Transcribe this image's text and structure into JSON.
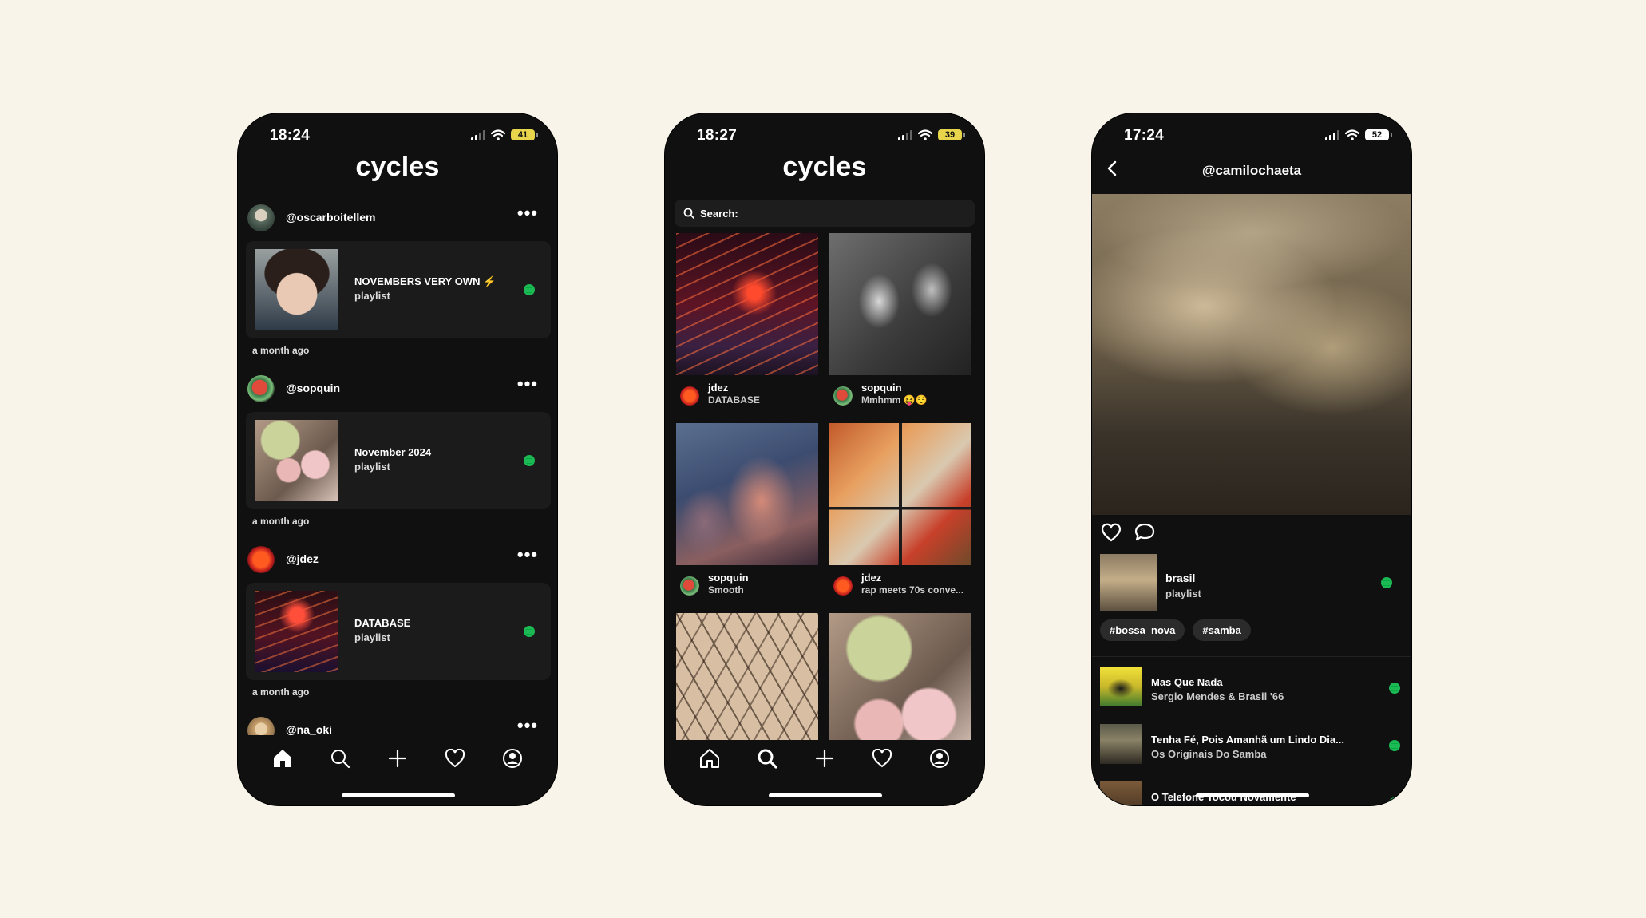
{
  "screen1": {
    "time": "18:24",
    "battery": "41",
    "app_title": "cycles",
    "posts": [
      {
        "user": "@oscarboitellem",
        "title": "NOVEMBERS VERY OWN",
        "type": "playlist",
        "ago": "a month ago"
      },
      {
        "user": "@sopquin",
        "title": "November 2024",
        "type": "playlist",
        "ago": "a month ago"
      },
      {
        "user": "@jdez",
        "title": "DATABASE",
        "type": "playlist",
        "ago": "a month ago"
      },
      {
        "user": "@na_oki"
      }
    ]
  },
  "screen2": {
    "time": "18:27",
    "battery": "39",
    "app_title": "cycles",
    "search_placeholder": "Search:",
    "grid": [
      {
        "user": "jdez",
        "desc": "DATABASE"
      },
      {
        "user": "sopquin",
        "desc": "Mmhmm 😝😌"
      },
      {
        "user": "sopquin",
        "desc": "Smooth"
      },
      {
        "user": "jdez",
        "desc": "rap meets 70s conve..."
      },
      {
        "user": "",
        "desc": ""
      },
      {
        "user": "",
        "desc": ""
      }
    ]
  },
  "screen3": {
    "time": "17:24",
    "battery": "52",
    "handle": "@camilochaeta",
    "playlist": {
      "name": "brasil",
      "type": "playlist"
    },
    "tags": [
      "#bossa_nova",
      "#samba"
    ],
    "tracks": [
      {
        "name": "Mas Que Nada",
        "artist": "Sergio Mendes & Brasil '66"
      },
      {
        "name": "Tenha Fé, Pois Amanhã um Lindo Dia...",
        "artist": "Os Originais Do Samba"
      },
      {
        "name": "O Telefone Tocou Novamente",
        "artist": ""
      }
    ]
  },
  "icons": [
    "home-icon",
    "search-icon",
    "plus-icon",
    "heart-icon",
    "profile-icon",
    "spotify-icon",
    "back-icon",
    "comment-icon",
    "wifi-icon",
    "signal-icon"
  ],
  "colors": {
    "background": "#f8f4ea",
    "phone": "#101010",
    "card": "#1b1b1b",
    "spotify": "#1db954",
    "battery": "#e8d54b"
  }
}
